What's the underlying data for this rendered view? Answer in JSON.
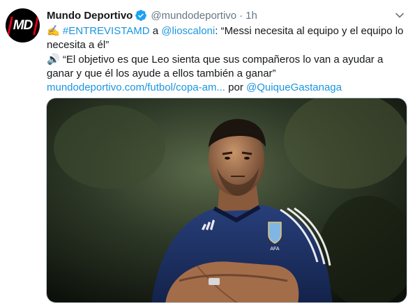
{
  "account": {
    "display_name": "Mundo Deportivo",
    "handle": "@mundodeportivo",
    "separator": "·",
    "time": "1h",
    "avatar_logo": "MD",
    "verified_icon": "verified-badge-icon",
    "menu_icon": "chevron-down-icon"
  },
  "tweet": {
    "emoji_write": "✍️",
    "hashtag": "#ENTREVISTAMD",
    "word_a": " a ",
    "mention_1": "@lioscaloni",
    "quote_1": ": “Messi necesita al equipo y el equipo lo necesita a él”",
    "emoji_speaker": "🔊",
    "quote_2": " “El objetivo es que Leo sienta que sus compañeros lo van a ayudar a ganar y que él los ayude a ellos también a ganar” ",
    "link": "mundodeportivo.com/futbol/copa-am...",
    "word_por": " por ",
    "mention_2": "@QuiqueGastanaga"
  },
  "media": {
    "jersey_badge": "AFA"
  },
  "colors": {
    "link": "#1b95e0",
    "verified": "#1da1f2",
    "secondary_text": "#657786",
    "avatar_accent": "#e2001a"
  }
}
